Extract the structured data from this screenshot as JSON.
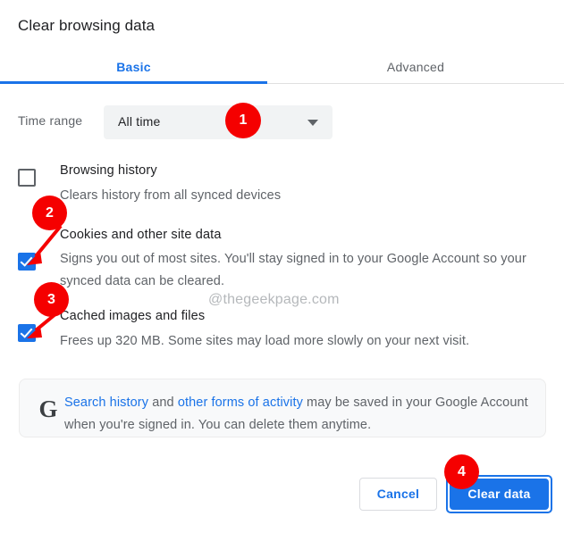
{
  "dialog": {
    "title": "Clear browsing data"
  },
  "tabs": [
    {
      "id": "basic",
      "label": "Basic",
      "active": true
    },
    {
      "id": "advanced",
      "label": "Advanced",
      "active": false
    }
  ],
  "time_range": {
    "label": "Time range",
    "selected": "All time",
    "arrow_icon": "chevron-down-icon"
  },
  "items": [
    {
      "id": "browsing-history",
      "title": "Browsing history",
      "description": "Clears history from all synced devices",
      "checked": false
    },
    {
      "id": "cookies-and-other-site-data",
      "title": "Cookies and other site data",
      "description": "Signs you out of most sites. You'll stay signed in to your Google Account so your synced data can be cleared.",
      "checked": true
    },
    {
      "id": "cached-images-and-files",
      "title": "Cached images and files",
      "description": "Frees up 320 MB. Some sites may load more slowly on your next visit.",
      "checked": true
    }
  ],
  "watermark": "@thegeekpage.com",
  "info_box": {
    "icon": "google-g-icon",
    "link_1": "Search history",
    "text_1": " and ",
    "link_2": "other forms of activity",
    "text_2": " may be saved in your Google Account when you're signed in. You can delete them anytime."
  },
  "footer": {
    "cancel_label": "Cancel",
    "clear_label": "Clear data"
  },
  "annotations": [
    {
      "number": "1"
    },
    {
      "number": "2"
    },
    {
      "number": "3"
    },
    {
      "number": "4"
    }
  ],
  "colors": {
    "accent_blue": "#1a73e8",
    "badge_red": "#f50000",
    "text_primary": "#202124",
    "text_secondary": "#5f6368",
    "field_bg": "#f1f3f4",
    "info_bg": "#f8f9fa"
  }
}
